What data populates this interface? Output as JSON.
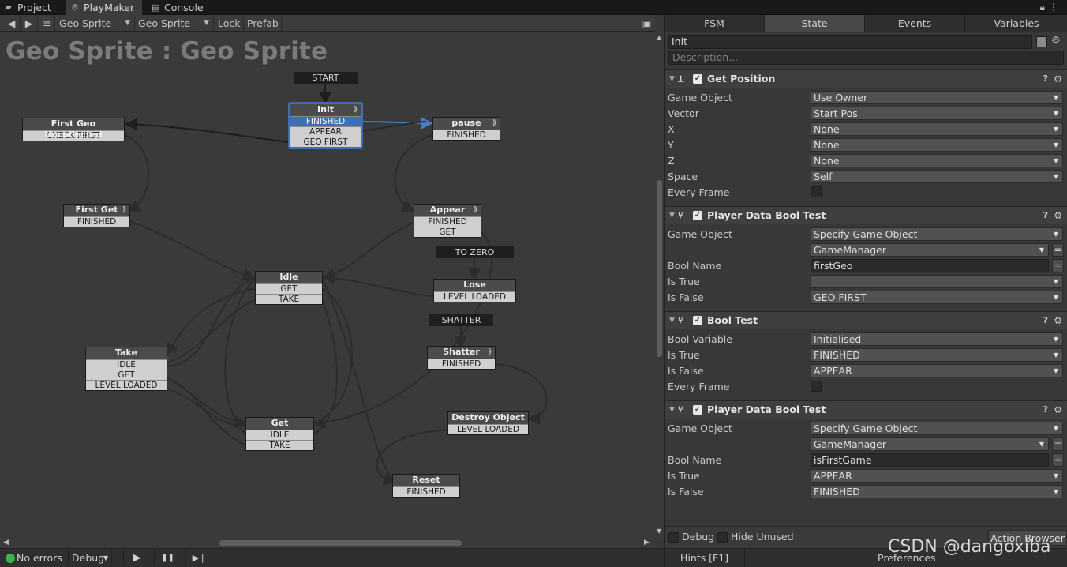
{
  "top_tabs": [
    {
      "label": "Project",
      "icon": "folder-icon"
    },
    {
      "label": "PlayMaker",
      "icon": "playmaker-icon"
    },
    {
      "label": "Console",
      "icon": "console-icon"
    }
  ],
  "toolbar": {
    "back": "◀",
    "forward": "▶",
    "menu": "≡",
    "game_object": "Geo Sprite",
    "fsm": "Geo Sprite",
    "lock": "Lock",
    "prefab": "Prefab"
  },
  "graph": {
    "title": "Geo Sprite : Geo Sprite",
    "labels": {
      "start": "START",
      "to_zero": "TO ZERO",
      "shatter": "SHATTER"
    },
    "states": {
      "init": {
        "name": "Init",
        "events": [
          "FINISHED",
          "APPEAR",
          "GEO FIRST"
        ]
      },
      "pause": {
        "name": "pause",
        "events": [
          "FINISHED"
        ]
      },
      "first_geo": {
        "name": "First Geo Uncollected",
        "events": [
          "CHECK FIRST"
        ]
      },
      "first_get": {
        "name": "First Get",
        "events": [
          "FINISHED"
        ]
      },
      "appear": {
        "name": "Appear",
        "events": [
          "FINISHED",
          "GET"
        ]
      },
      "idle": {
        "name": "Idle",
        "events": [
          "GET",
          "TAKE"
        ]
      },
      "lose": {
        "name": "Lose",
        "events": [
          "LEVEL LOADED"
        ]
      },
      "take": {
        "name": "Take",
        "events": [
          "IDLE",
          "GET",
          "LEVEL LOADED"
        ]
      },
      "shatter": {
        "name": "Shatter",
        "events": [
          "FINISHED"
        ]
      },
      "get": {
        "name": "Get",
        "events": [
          "IDLE",
          "TAKE"
        ]
      },
      "destroy": {
        "name": "Destroy Object",
        "events": [
          "LEVEL LOADED"
        ]
      },
      "reset": {
        "name": "Reset",
        "events": [
          "FINISHED"
        ]
      }
    }
  },
  "bottom": {
    "errors": "No errors",
    "debug": "Debug",
    "play": "▶",
    "pause": "❚❚",
    "step": "▶❘"
  },
  "panel": {
    "tabs": [
      "FSM",
      "State",
      "Events",
      "Variables"
    ],
    "state_name": "Init",
    "description_placeholder": "Description...",
    "actions": [
      {
        "name": "Get Position",
        "icon": "axis-icon",
        "params": [
          {
            "label": "Game Object",
            "kind": "dropdown",
            "value": "Use Owner"
          },
          {
            "label": "Vector",
            "kind": "dropdown",
            "value": "Start Pos"
          },
          {
            "label": "X",
            "kind": "dropdown",
            "value": "None"
          },
          {
            "label": "Y",
            "kind": "dropdown",
            "value": "None"
          },
          {
            "label": "Z",
            "kind": "dropdown",
            "value": "None"
          },
          {
            "label": "Space",
            "kind": "dropdown",
            "value": "Self"
          },
          {
            "label": "Every Frame",
            "kind": "checkbox",
            "value": ""
          }
        ]
      },
      {
        "name": "Player Data Bool Test",
        "icon": "branch-icon",
        "params": [
          {
            "label": "Game Object",
            "kind": "dropdown",
            "value": "Specify Game Object"
          },
          {
            "label": "",
            "kind": "dropdown-eq",
            "value": "GameManager"
          },
          {
            "label": "Bool Name",
            "kind": "text-eq",
            "value": "firstGeo"
          },
          {
            "label": "Is True",
            "kind": "dropdown",
            "value": ""
          },
          {
            "label": "Is False",
            "kind": "dropdown",
            "value": "GEO FIRST"
          }
        ]
      },
      {
        "name": "Bool Test",
        "icon": "branch-icon",
        "params": [
          {
            "label": "Bool Variable",
            "kind": "dropdown",
            "value": "Initialised"
          },
          {
            "label": "Is True",
            "kind": "dropdown",
            "value": "FINISHED"
          },
          {
            "label": "Is False",
            "kind": "dropdown",
            "value": "APPEAR"
          },
          {
            "label": "Every Frame",
            "kind": "checkbox",
            "value": ""
          }
        ]
      },
      {
        "name": "Player Data Bool Test",
        "icon": "branch-icon",
        "params": [
          {
            "label": "Game Object",
            "kind": "dropdown",
            "value": "Specify Game Object"
          },
          {
            "label": "",
            "kind": "dropdown-eq",
            "value": "GameManager"
          },
          {
            "label": "Bool Name",
            "kind": "text-eq",
            "value": "isFirstGame"
          },
          {
            "label": "Is True",
            "kind": "dropdown",
            "value": "APPEAR"
          },
          {
            "label": "Is False",
            "kind": "dropdown",
            "value": "FINISHED"
          }
        ]
      }
    ],
    "footer": {
      "debug": "Debug",
      "hide_unused": "Hide Unused",
      "action_browser": "Action Browser",
      "hints": "Hints [F1]",
      "preferences": "Preferences"
    }
  },
  "watermark": "CSDN @dangoxiba"
}
